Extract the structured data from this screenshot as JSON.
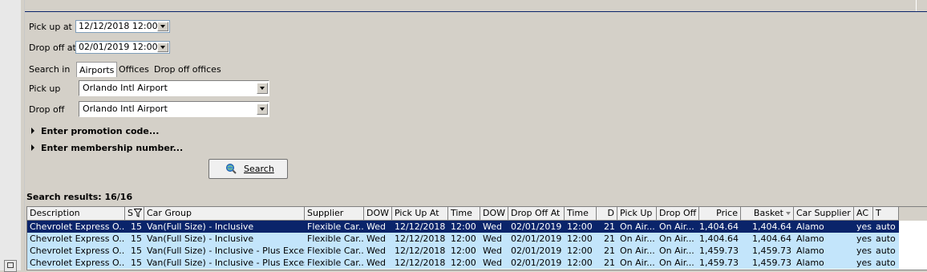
{
  "form": {
    "pickup_at_label": "Pick up at",
    "pickup_at_value": "12/12/2018 12:00",
    "dropoff_at_label": "Drop off at",
    "dropoff_at_value": "02/01/2019 12:00",
    "search_in_label": "Search in",
    "tabs": [
      {
        "label": "Airports",
        "active": true
      },
      {
        "label": "Offices",
        "active": false
      },
      {
        "label": "Drop off offices",
        "active": false
      }
    ],
    "pickup_label": "Pick up",
    "pickup_value": "Orlando Intl Airport",
    "dropoff_label": "Drop off",
    "dropoff_value": "Orlando Intl Airport",
    "promo_label": "Enter promotion code...",
    "membership_label": "Enter membership number...",
    "search_button": "Search"
  },
  "results": {
    "title": "Search results: 16/16",
    "columns": [
      "Description",
      "S",
      "Car Group",
      "Supplier",
      "DOW",
      "Pick Up At",
      "Time",
      "DOW",
      "Drop Off At",
      "Time",
      "D",
      "Pick Up",
      "Drop Off",
      "Price",
      "Basket",
      "Car Supplier",
      "AC",
      "T"
    ],
    "rows": [
      [
        "Chevrolet Express O...",
        "15",
        "Van(Full Size) - Inclusive",
        "Flexible Car...",
        "Wed",
        "12/12/2018",
        "12:00",
        "Wed",
        "02/01/2019",
        "12:00",
        "21",
        "On Air...",
        "On Air...",
        "1,404.64",
        "1,404.64",
        "Alamo",
        "yes",
        "auto"
      ],
      [
        "Chevrolet Express O...",
        "15",
        "Van(Full Size) - Inclusive",
        "Flexible Car...",
        "Wed",
        "12/12/2018",
        "12:00",
        "Wed",
        "02/01/2019",
        "12:00",
        "21",
        "On Air...",
        "On Air...",
        "1,404.64",
        "1,404.64",
        "Alamo",
        "yes",
        "auto"
      ],
      [
        "Chevrolet Express O...",
        "15",
        "Van(Full Size) - Inclusive - Plus Excess...",
        "Flexible Car...",
        "Wed",
        "12/12/2018",
        "12:00",
        "Wed",
        "02/01/2019",
        "12:00",
        "21",
        "On Air...",
        "On Air...",
        "1,459.73",
        "1,459.73",
        "Alamo",
        "yes",
        "auto"
      ],
      [
        "Chevrolet Express O...",
        "15",
        "Van(Full Size) - Inclusive - Plus Excess...",
        "Flexible Car...",
        "Wed",
        "12/12/2018",
        "12:00",
        "Wed",
        "02/01/2019",
        "12:00",
        "21",
        "On Air...",
        "On Air...",
        "1,459.73",
        "1,459.73",
        "Alamo",
        "yes",
        "auto"
      ]
    ],
    "selected_row": 0
  },
  "icons": {
    "search": "magnifier-globe-icon",
    "filter": "filter-icon",
    "sort": "sort-descending-icon",
    "expand": "triangle-right-icon",
    "dropdown": "chevron-down-icon"
  },
  "colors": {
    "selection": "#0a246a",
    "row_highlight": "#c3e5fb",
    "window_bg": "#d4d0c8"
  }
}
